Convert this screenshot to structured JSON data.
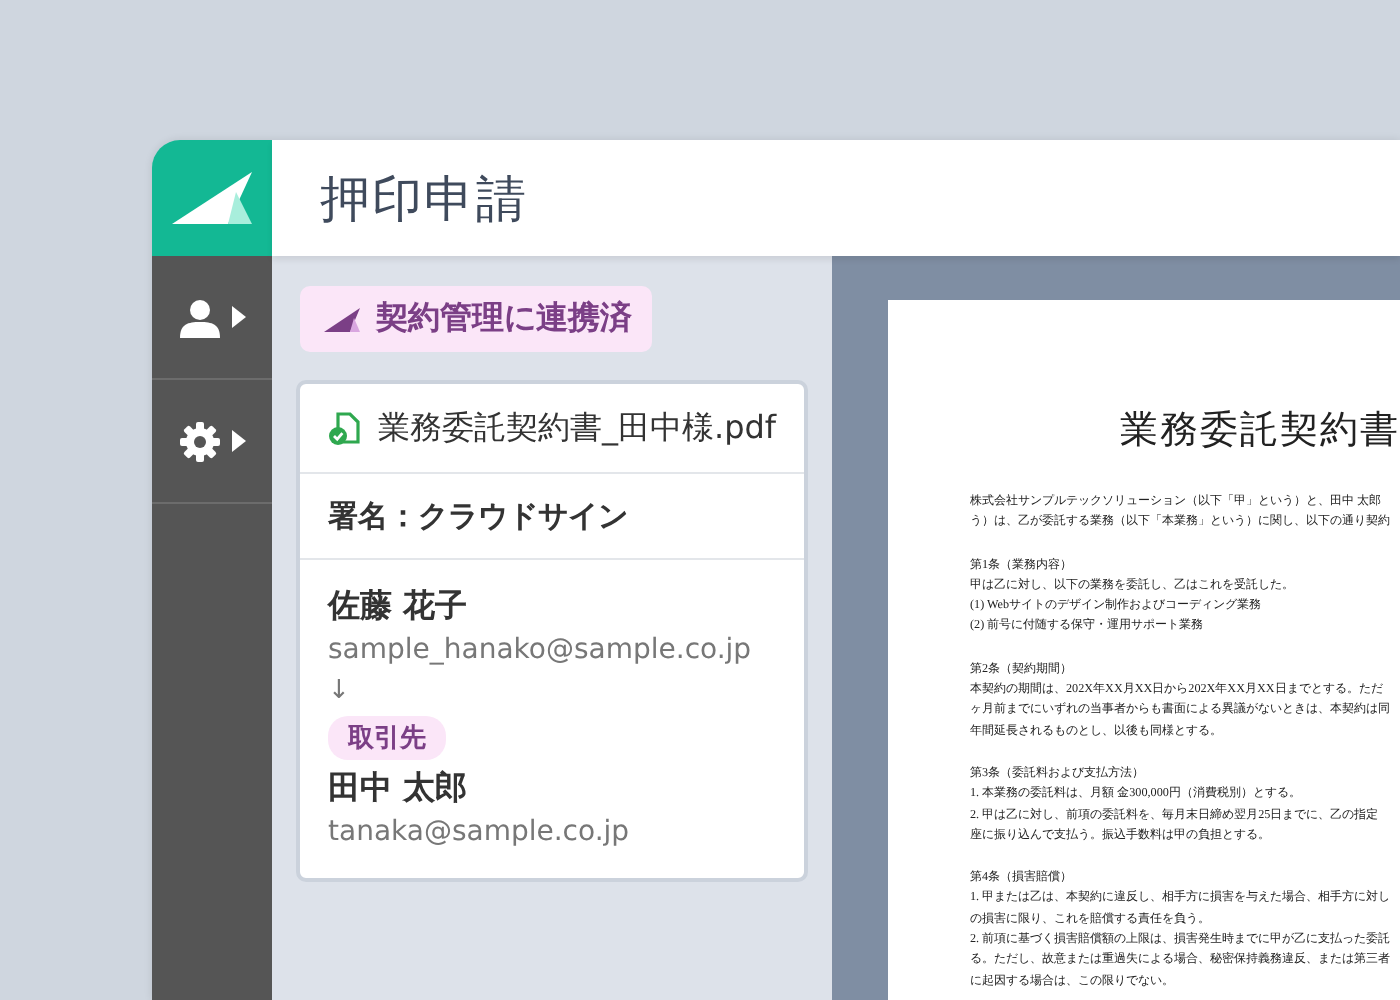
{
  "header": {
    "title": "押印申請"
  },
  "status_badge": {
    "text": "契約管理に連携済"
  },
  "card": {
    "file_name": "業務委託契約書_田中様.pdf",
    "signature_method": "署名：クラウドサイン",
    "sender": {
      "name": "佐藤 花子",
      "email": "sample_hanako@sample.co.jp"
    },
    "arrow": "↓",
    "recipient": {
      "tag": "取引先",
      "name": "田中 太郎",
      "email": "tanaka@sample.co.jp"
    }
  },
  "document": {
    "title": "業務委託契約書",
    "intro": [
      "株式会社サンプルテックソリューション（以下「甲」という）と、田中 太郎",
      "う）は、乙が委託する業務（以下「本業務」という）に関し、以下の通り契約"
    ],
    "sections": [
      {
        "heading": "第1条（業務内容）",
        "lines": [
          "甲は乙に対し、以下の業務を委託し、乙はこれを受託した。",
          "(1) Webサイトのデザイン制作およびコーディング業務",
          "(2) 前号に付随する保守・運用サポート業務"
        ]
      },
      {
        "heading": "第2条（契約期間）",
        "lines": [
          "本契約の期間は、202X年XX月XX日から202X年XX月XX日までとする。ただ",
          "ヶ月前までにいずれの当事者からも書面による異議がないときは、本契約は同",
          "年間延長されるものとし、以後も同様とする。"
        ]
      },
      {
        "heading": "第3条（委託料および支払方法）",
        "lines": [
          "1. 本業務の委託料は、月額 金300,000円（消費税別）とする。",
          "2. 甲は乙に対し、前項の委託料を、毎月末日締め翌月25日までに、乙の指定",
          "座に振り込んで支払う。振込手数料は甲の負担とする。"
        ]
      },
      {
        "heading": "第4条（損害賠償）",
        "lines": [
          "1. 甲または乙は、本契約に違反し、相手方に損害を与えた場合、相手方に対し",
          "の損害に限り、これを賠償する責任を負う。",
          "2. 前項に基づく損害賠償額の上限は、損害発生時までに甲が乙に支払った委託",
          "る。ただし、故意または重過失による場合、秘密保持義務違反、または第三者",
          "に起因する場合は、この限りでない。"
        ]
      }
    ]
  }
}
